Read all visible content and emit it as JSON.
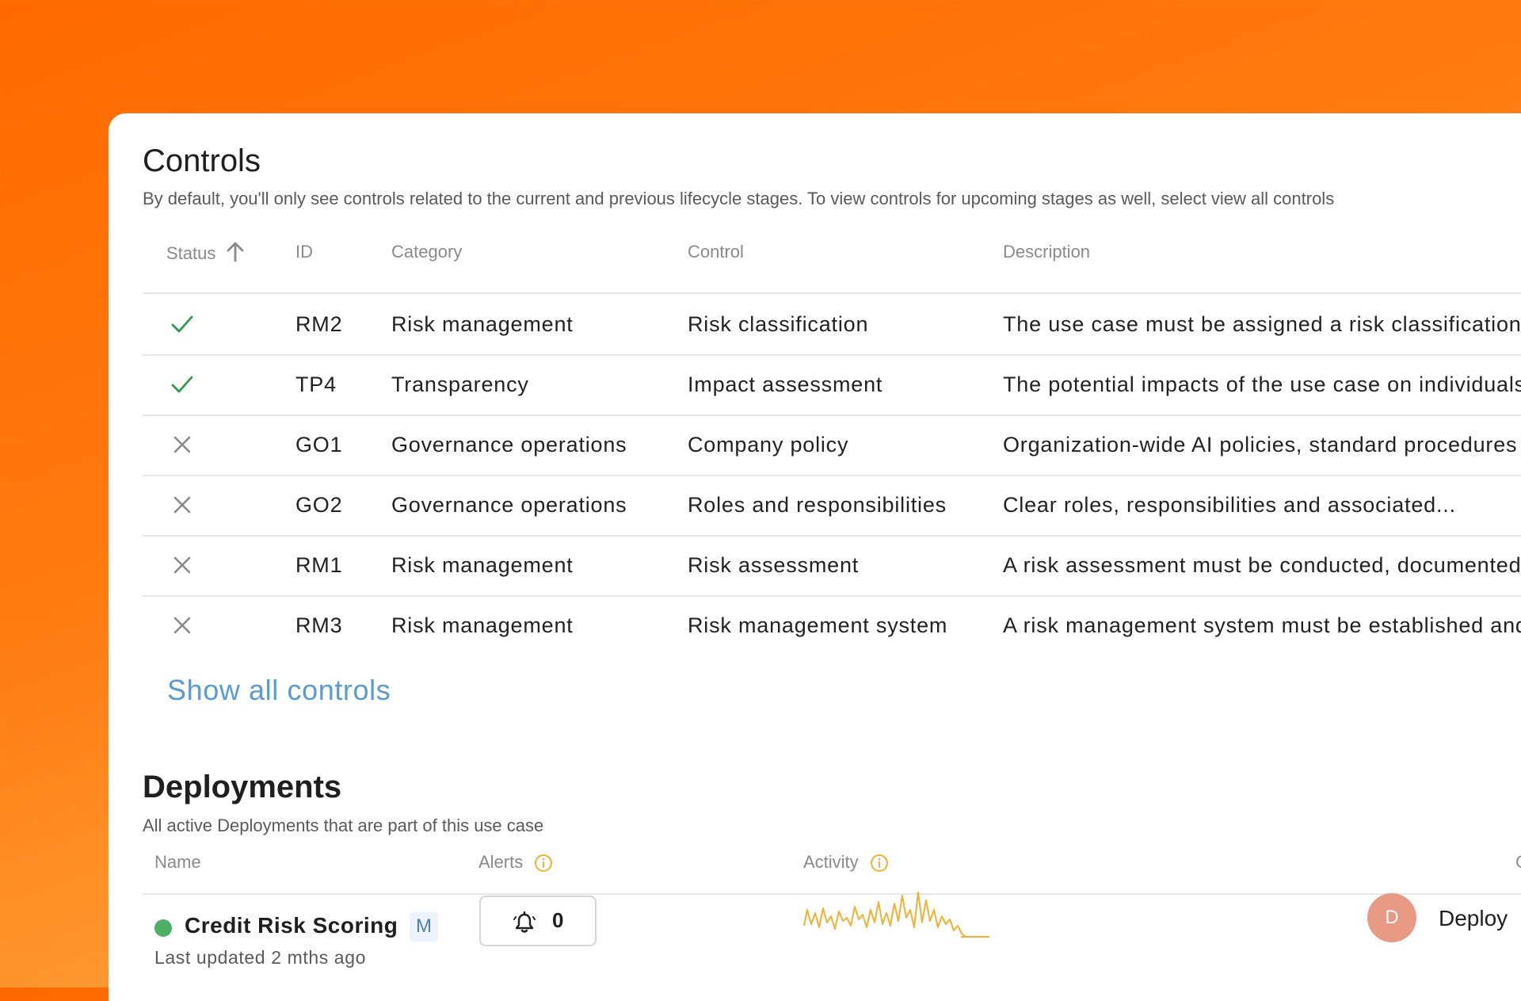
{
  "controls": {
    "title": "Controls",
    "description": "By default, you'll only see controls related to the current and previous lifecycle stages. To view controls for upcoming stages as well, select view all controls",
    "headers": {
      "status": "Status",
      "id": "ID",
      "category": "Category",
      "control": "Control",
      "description": "Description"
    },
    "rows": [
      {
        "status": "complete",
        "id": "RM2",
        "category": "Risk management",
        "control": "Risk classification",
        "description": "The use case must be assigned a risk classification"
      },
      {
        "status": "complete",
        "id": "TP4",
        "category": "Transparency",
        "control": "Impact assessment",
        "description": "The potential impacts of the use case on individuals"
      },
      {
        "status": "incomplete",
        "id": "GO1",
        "category": "Governance operations",
        "control": "Company policy",
        "description": "Organization-wide AI policies, standard procedures"
      },
      {
        "status": "incomplete",
        "id": "GO2",
        "category": "Governance operations",
        "control": "Roles and responsibilities",
        "description": "Clear roles, responsibilities and associated..."
      },
      {
        "status": "incomplete",
        "id": "RM1",
        "category": "Risk management",
        "control": "Risk assessment",
        "description": "A risk assessment must be conducted, documented"
      },
      {
        "status": "incomplete",
        "id": "RM3",
        "category": "Risk management",
        "control": "Risk management system",
        "description": "A risk management system must be established and"
      }
    ],
    "show_all_label": "Show all controls"
  },
  "deployments": {
    "title": "Deployments",
    "description": "All active Deployments that are part of this use case",
    "headers": {
      "name": "Name",
      "alerts": "Alerts",
      "activity": "Activity",
      "overflow": "C"
    },
    "rows": [
      {
        "name": "Credit Risk Scoring",
        "badge": "M",
        "updated": "Last updated 2 mths ago",
        "alerts": "0",
        "avatar_initial": "D",
        "deploy_label": "Deploy"
      }
    ]
  },
  "colors": {
    "check": "#2e9a4c",
    "cross": "#8a8a8a",
    "link": "#5b9bd5",
    "status_dot": "#4caf63",
    "activity": "#f2b134",
    "info": "#f2b134"
  },
  "icons": {
    "status_sort": "arrow-up-icon",
    "complete": "check-icon",
    "incomplete": "x-icon",
    "info": "info-icon",
    "alerts": "bell-icon"
  }
}
